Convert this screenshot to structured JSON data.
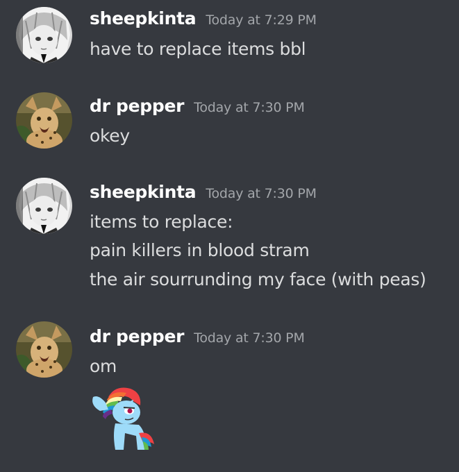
{
  "messages": [
    {
      "author": "sheepkinta",
      "timestamp": "Today at 7:29 PM",
      "avatar_icon": "anime-girl-avatar",
      "lines": [
        "have to replace items bbl"
      ]
    },
    {
      "author": "dr pepper",
      "timestamp": "Today at 7:30 PM",
      "avatar_icon": "serval-cat-avatar",
      "lines": [
        "okey"
      ]
    },
    {
      "author": "sheepkinta",
      "timestamp": "Today at 7:30 PM",
      "avatar_icon": "anime-girl-avatar",
      "lines": [
        "items to replace:",
        "pain killers in blood stram",
        "the air sourrunding my face (with peas)"
      ]
    },
    {
      "author": "dr pepper",
      "timestamp": "Today at 7:30 PM",
      "avatar_icon": "serval-cat-avatar",
      "lines": [
        "om"
      ],
      "sticker": "rainbow-pony-salute-sticker"
    }
  ],
  "colors": {
    "background": "#36393f",
    "author": "#ffffff",
    "timestamp": "#a3a6aa",
    "text": "#dcddde"
  }
}
